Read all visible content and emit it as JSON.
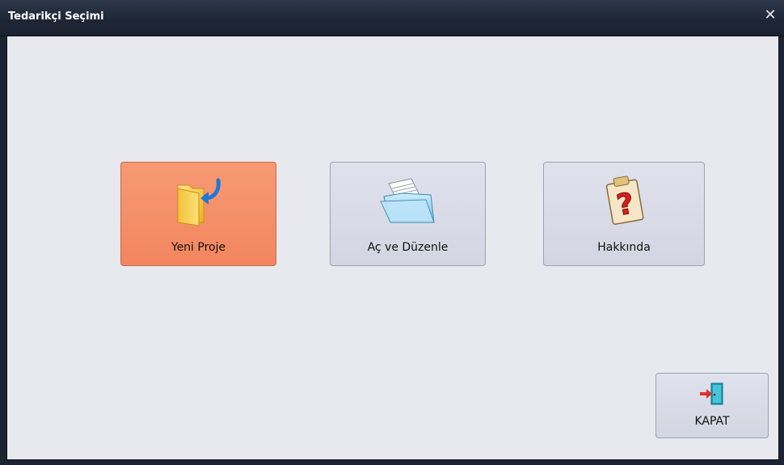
{
  "window": {
    "title": "Tedarikçi Seçimi",
    "close_glyph": "✕"
  },
  "buttons": {
    "new_project": {
      "label": "Yeni Proje",
      "icon": "folder-new-icon"
    },
    "open_edit": {
      "label": "Aç ve Düzenle",
      "icon": "open-folder-icon"
    },
    "about": {
      "label": "Hakkında",
      "icon": "help-clipboard-icon"
    },
    "close": {
      "label": "KAPAT",
      "icon": "exit-door-icon"
    }
  },
  "colors": {
    "active_tile": "#f2865f",
    "tile": "#d8dbe6",
    "client_bg": "#e8e9ee",
    "titlebar": "#1f2736"
  }
}
